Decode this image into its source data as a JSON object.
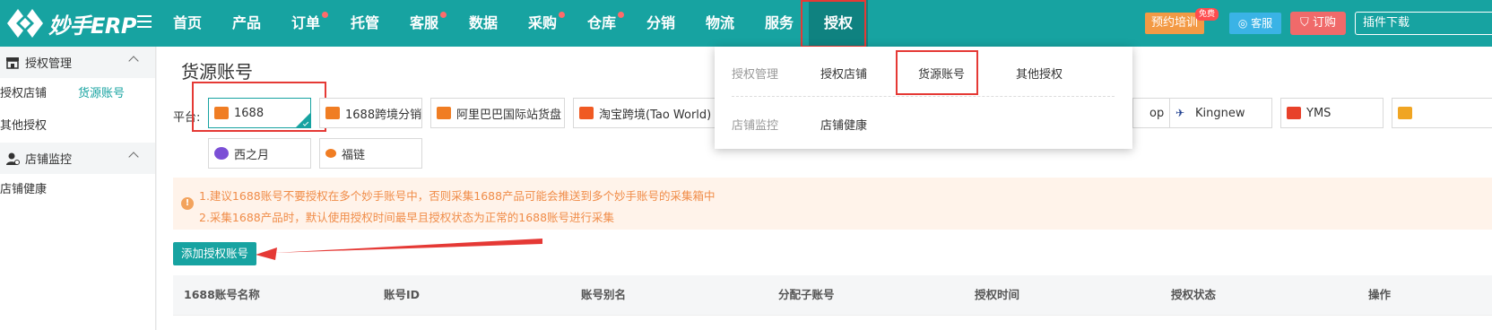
{
  "brand": {
    "logo_text": "妙手ERP"
  },
  "nav": {
    "items": [
      {
        "label": "首页",
        "dot": false
      },
      {
        "label": "产品",
        "dot": false
      },
      {
        "label": "订单",
        "dot": true
      },
      {
        "label": "托管",
        "dot": false
      },
      {
        "label": "客服",
        "dot": true
      },
      {
        "label": "数据",
        "dot": false
      },
      {
        "label": "采购",
        "dot": true
      },
      {
        "label": "仓库",
        "dot": true
      },
      {
        "label": "分销",
        "dot": false
      },
      {
        "label": "物流",
        "dot": false
      },
      {
        "label": "服务",
        "dot": false
      },
      {
        "label": "授权",
        "dot": false,
        "active": true
      }
    ]
  },
  "header_actions": {
    "training": "预约培训",
    "free_badge": "免费",
    "service": "客服",
    "order": "订购",
    "plugin": "插件下载"
  },
  "sidebar": {
    "groups": [
      {
        "title": "授权管理",
        "items": [
          "授权店铺",
          "货源账号",
          "其他授权"
        ],
        "active_item": "货源账号"
      },
      {
        "title": "店铺监控",
        "items": [
          "店铺健康"
        ]
      }
    ]
  },
  "page": {
    "title": "货源账号",
    "platform_label": "平台:"
  },
  "platforms": {
    "row1": [
      "1688",
      "1688跨境分销",
      "阿里巴巴国际站货盘",
      "淘宝跨境(Tao World)"
    ],
    "right_visible": [
      "op",
      "Kingnew",
      "YMS"
    ],
    "row2": [
      "西之月",
      "福链"
    ],
    "selected": "1688"
  },
  "notice": {
    "line1": "1.建议1688账号不要授权在多个妙手账号中，否则采集1688产品可能会推送到多个妙手账号的采集箱中",
    "line2": "2.采集1688产品时，默认使用授权时间最早且授权状态为正常的1688账号进行采集"
  },
  "actions": {
    "add_account": "添加授权账号"
  },
  "table": {
    "columns": [
      "1688账号名称",
      "账号ID",
      "账号别名",
      "分配子账号",
      "授权时间",
      "授权状态",
      "操作"
    ]
  },
  "dropdown": {
    "section1_label": "授权管理",
    "section1_links": [
      "授权店铺",
      "货源账号",
      "其他授权"
    ],
    "section2_label": "店铺监控",
    "section2_links": [
      "店铺健康"
    ]
  },
  "colors": {
    "primary": "#17a3a1",
    "primary_dark": "#0f8280",
    "highlight": "#e53935",
    "notice_bg": "#fff3ea",
    "notice_text": "#f08c48",
    "orange_icon": "#f07d23"
  }
}
